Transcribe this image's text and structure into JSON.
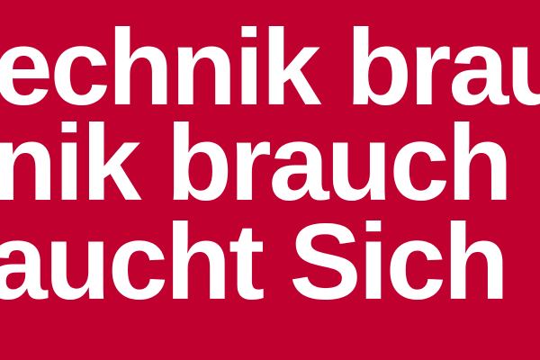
{
  "background_color": "#c0002f",
  "text_color": "#ffffff",
  "lines": [
    "echnik brau",
    "nik brauch",
    "aucht Sich"
  ]
}
